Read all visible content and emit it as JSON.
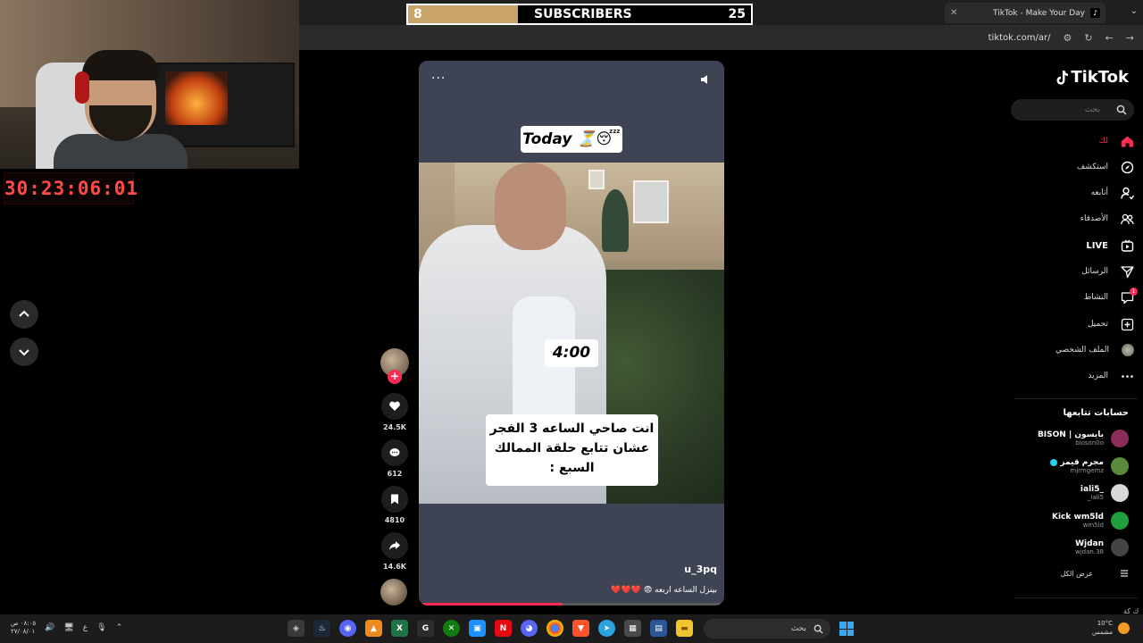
{
  "overlay": {
    "subscribers": {
      "current": "8",
      "label": "SUBSCRIBERS",
      "goal": "25",
      "progress_fraction": 0.32
    },
    "timer": "30:23:06:01"
  },
  "browser": {
    "tab_title": "TikTok - Make Your Day",
    "url": "tiktok.com/ar/",
    "new_tab_symbol": "+",
    "close_symbol": "✕"
  },
  "video": {
    "caption_top": "Today ⏳😴",
    "caption_time": "4:00",
    "caption_ar": "انت صاحي الساعه 3 الفجر عشان تتابع حلقة الممالك السبع :",
    "author": "u_3pq",
    "description": "بينزل الساعه اربعه 😨 ❤️❤️❤️",
    "more_symbol": "···",
    "progress_fraction": 0.47
  },
  "actions": {
    "likes": "24.5K",
    "comments": "612",
    "saves": "4810",
    "shares": "14.6K",
    "follow_symbol": "+"
  },
  "sidebar": {
    "brand": "TikTok",
    "search_placeholder": "بحث",
    "nav": [
      {
        "label": "لك",
        "icon": "home-icon"
      },
      {
        "label": "استكشف",
        "icon": "compass-icon"
      },
      {
        "label": "أتابعه",
        "icon": "user-follow-icon"
      },
      {
        "label": "الأصدقاء",
        "icon": "friends-icon"
      },
      {
        "label": "LIVE",
        "icon": "live-icon"
      },
      {
        "label": "الرسائل",
        "icon": "send-icon"
      },
      {
        "label": "النشاط",
        "icon": "activity-icon",
        "badge": "1"
      },
      {
        "label": "تحميل",
        "icon": "upload-icon"
      },
      {
        "label": "الملف الشخصي",
        "icon": "profile-avatar"
      },
      {
        "label": "المزيد",
        "icon": "more-icon"
      }
    ],
    "following_title": "حسابات تتابعها",
    "following": [
      {
        "name": "BISON | بايسون",
        "handle": "bioson0o",
        "color": "#8a2d5a"
      },
      {
        "name": "مجرم قيمز",
        "handle": "mjrmgemz",
        "color": "#5b8a3a",
        "verified": true
      },
      {
        "name": "iali5_",
        "handle": "_iali5",
        "color": "#d8d8d8"
      },
      {
        "name": "Kick wm5ld",
        "handle": "wm5ld",
        "color": "#1f9e3b"
      },
      {
        "name": "Wjdan",
        "handle": "wjdan.38",
        "color": "#444"
      }
    ],
    "see_all": "عرض الكل"
  },
  "taskbar": {
    "clock_time": "٠٨:٠٥ ص",
    "clock_date": "٢٧/٠٨/٠١",
    "lang": "ع",
    "search_text": "بحث",
    "weather_temp": "10°C",
    "weather_desc": "مشمس",
    "corner": "ك كة"
  },
  "colors": {
    "accent": "#fe2c55",
    "bar_gold": "#c8a46a",
    "timer_red": "#ff4a4a"
  }
}
